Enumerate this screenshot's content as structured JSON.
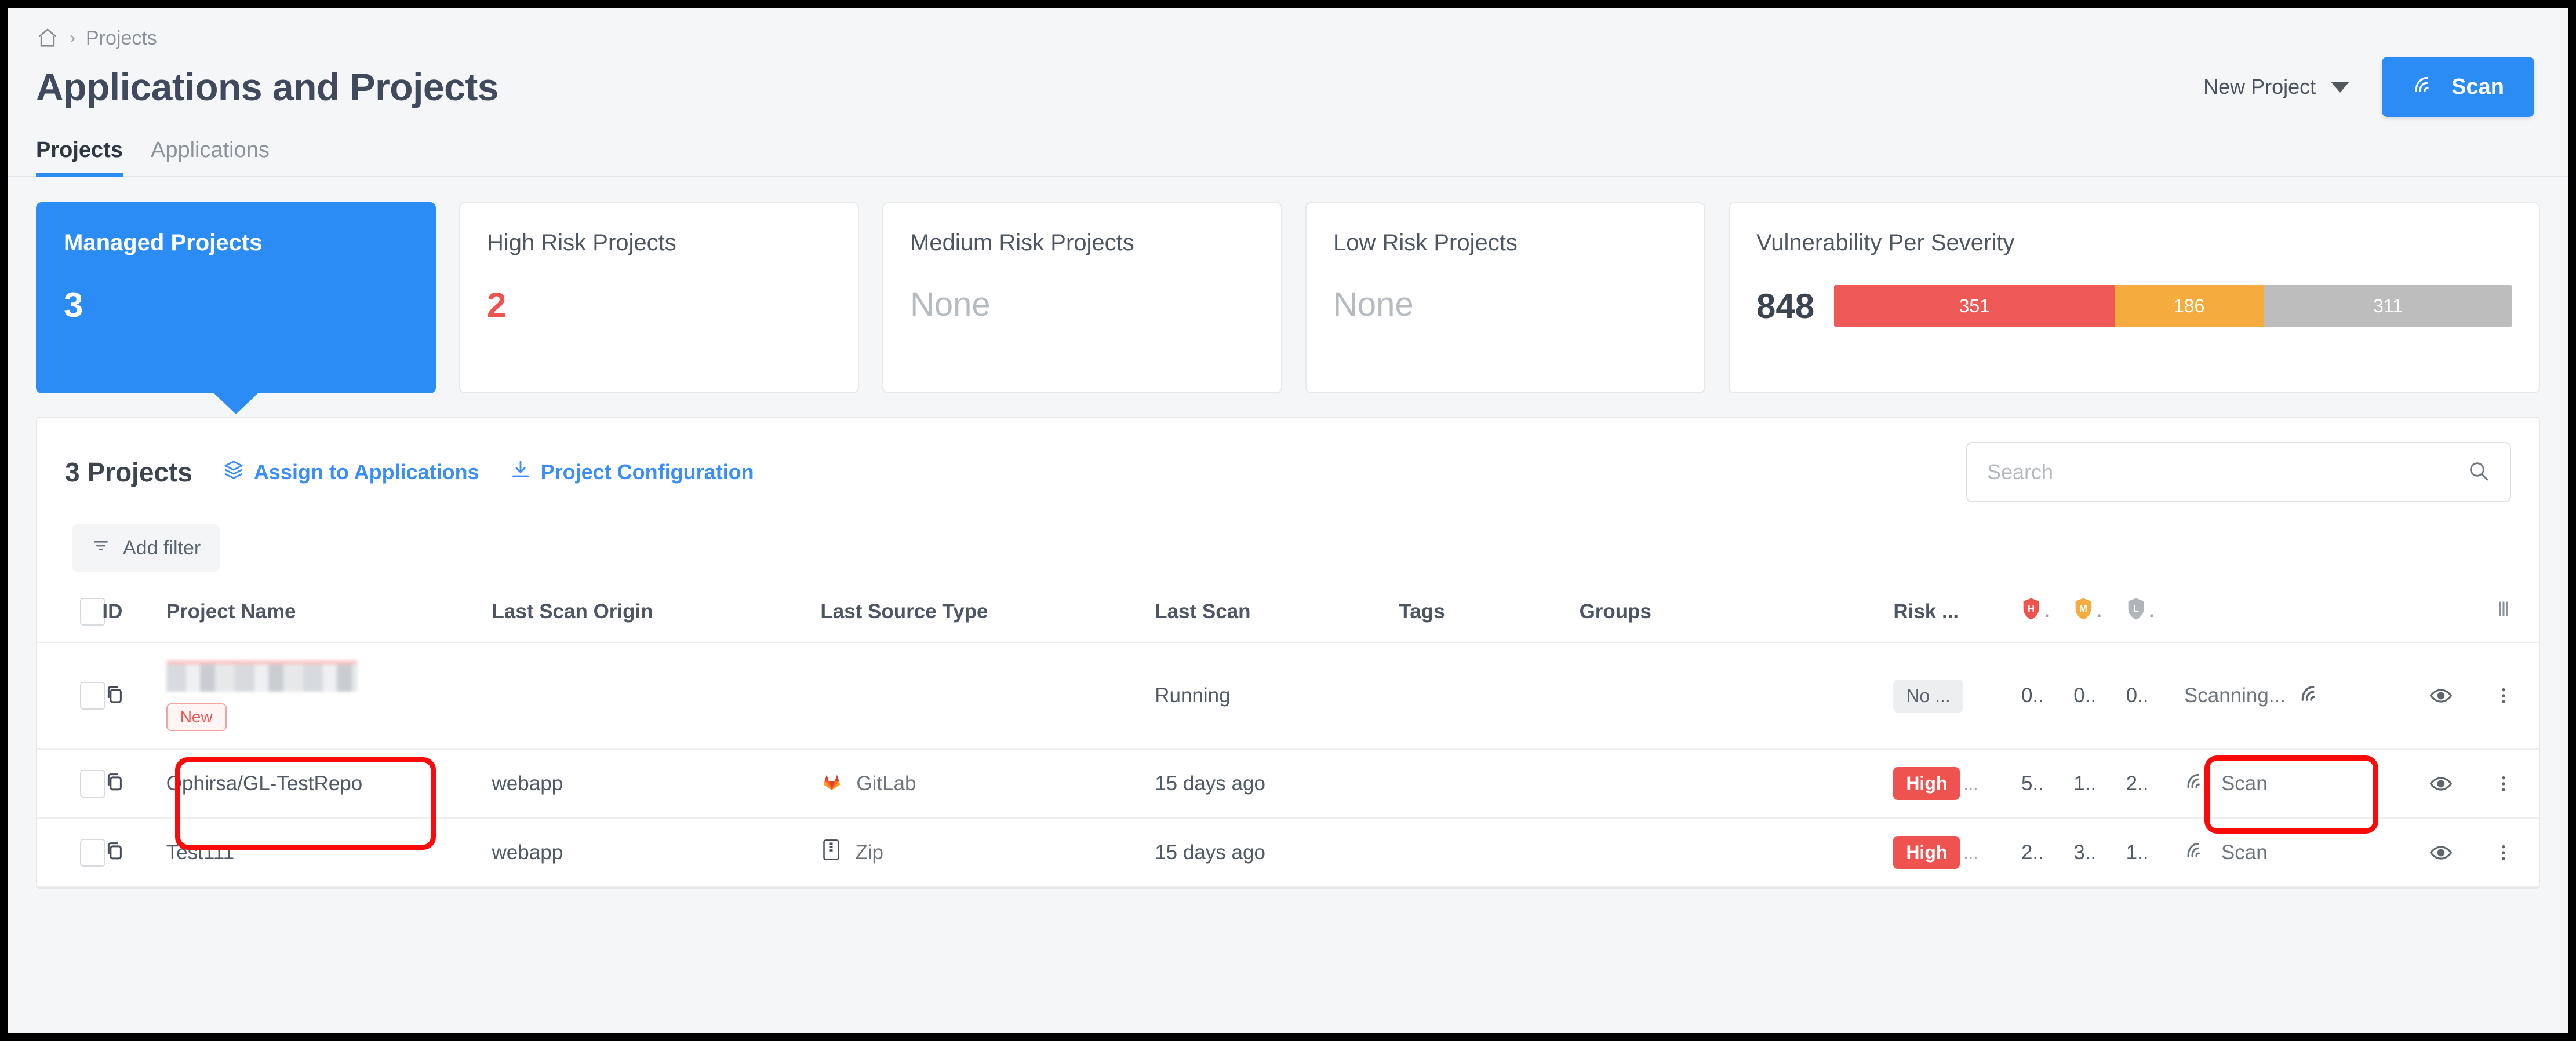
{
  "breadcrumb": {
    "home_icon": "home-icon",
    "separator": "›",
    "current": "Projects"
  },
  "header": {
    "title": "Applications and Projects",
    "new_project_label": "New Project",
    "scan_button_label": "Scan"
  },
  "tabs": [
    {
      "label": "Projects",
      "active": true
    },
    {
      "label": "Applications",
      "active": false
    }
  ],
  "cards": [
    {
      "label": "Managed Projects",
      "value": "3",
      "selected": true
    },
    {
      "label": "High Risk Projects",
      "value": "2",
      "style": "danger"
    },
    {
      "label": "Medium Risk Projects",
      "value": "None",
      "style": "muted"
    },
    {
      "label": "Low Risk Projects",
      "value": "None",
      "style": "muted"
    }
  ],
  "severity_card": {
    "label": "Vulnerability Per Severity",
    "total": "848",
    "segments": [
      {
        "name": "high",
        "value": "351",
        "color": "#ef5a58"
      },
      {
        "name": "medium",
        "value": "186",
        "color": "#f6ab3e"
      },
      {
        "name": "low",
        "value": "311",
        "color": "#bdbdbd"
      }
    ]
  },
  "toolbar": {
    "count_title": "3 Projects",
    "assign_label": "Assign to Applications",
    "config_label": "Project Configuration",
    "search_placeholder": "Search",
    "search_value": "",
    "add_filter_label": "Add filter"
  },
  "table": {
    "columns": [
      "ID",
      "Project Name",
      "Last Scan Origin",
      "Last Source Type",
      "Last Scan",
      "Tags",
      "Groups",
      "Risk ..."
    ],
    "severity_headers": [
      {
        "letter": "H",
        "label": "H.",
        "color": "#ef5350"
      },
      {
        "letter": "M",
        "label": "M.",
        "color": "#f6ab3e"
      },
      {
        "letter": "L",
        "label": "L.",
        "color": "#b0b5bb"
      }
    ],
    "rows": [
      {
        "id_icon": "copy-icon",
        "name": "",
        "name_redacted": true,
        "badge": "New",
        "origin": "",
        "source_type": "",
        "source_icon": "",
        "last_scan": "Running",
        "tags": "",
        "groups": "",
        "risk": "No ...",
        "risk_style": "none",
        "high": "0..",
        "medium": "0..",
        "low": "0..",
        "action": "Scanning...",
        "action_icon": "scanning-icon",
        "highlighted": true
      },
      {
        "id_icon": "copy-icon",
        "name": "Ophirsa/GL-TestRepo",
        "name_redacted": false,
        "badge": "",
        "origin": "webapp",
        "source_type": "GitLab",
        "source_icon": "gitlab-icon",
        "last_scan": "15 days ago",
        "tags": "",
        "groups": "",
        "risk": "High",
        "risk_style": "high",
        "risk_suffix": "...",
        "high": "5..",
        "medium": "1..",
        "low": "2..",
        "action": "Scan",
        "action_icon": "scan-icon",
        "highlighted": false
      },
      {
        "id_icon": "copy-icon",
        "name": "Test111",
        "name_redacted": false,
        "badge": "",
        "origin": "webapp",
        "source_type": "Zip",
        "source_icon": "zip-icon",
        "last_scan": "15 days ago",
        "tags": "",
        "groups": "",
        "risk": "High",
        "risk_style": "high",
        "risk_suffix": "...",
        "high": "2..",
        "medium": "3..",
        "low": "1..",
        "action": "Scan",
        "action_icon": "scan-icon",
        "highlighted": false
      }
    ]
  },
  "colors": {
    "accent": "#2b8cf5",
    "danger": "#ef5350",
    "warning": "#f6ab3e",
    "neutral": "#bdbdbd",
    "annotation": "#fb0a0a"
  }
}
